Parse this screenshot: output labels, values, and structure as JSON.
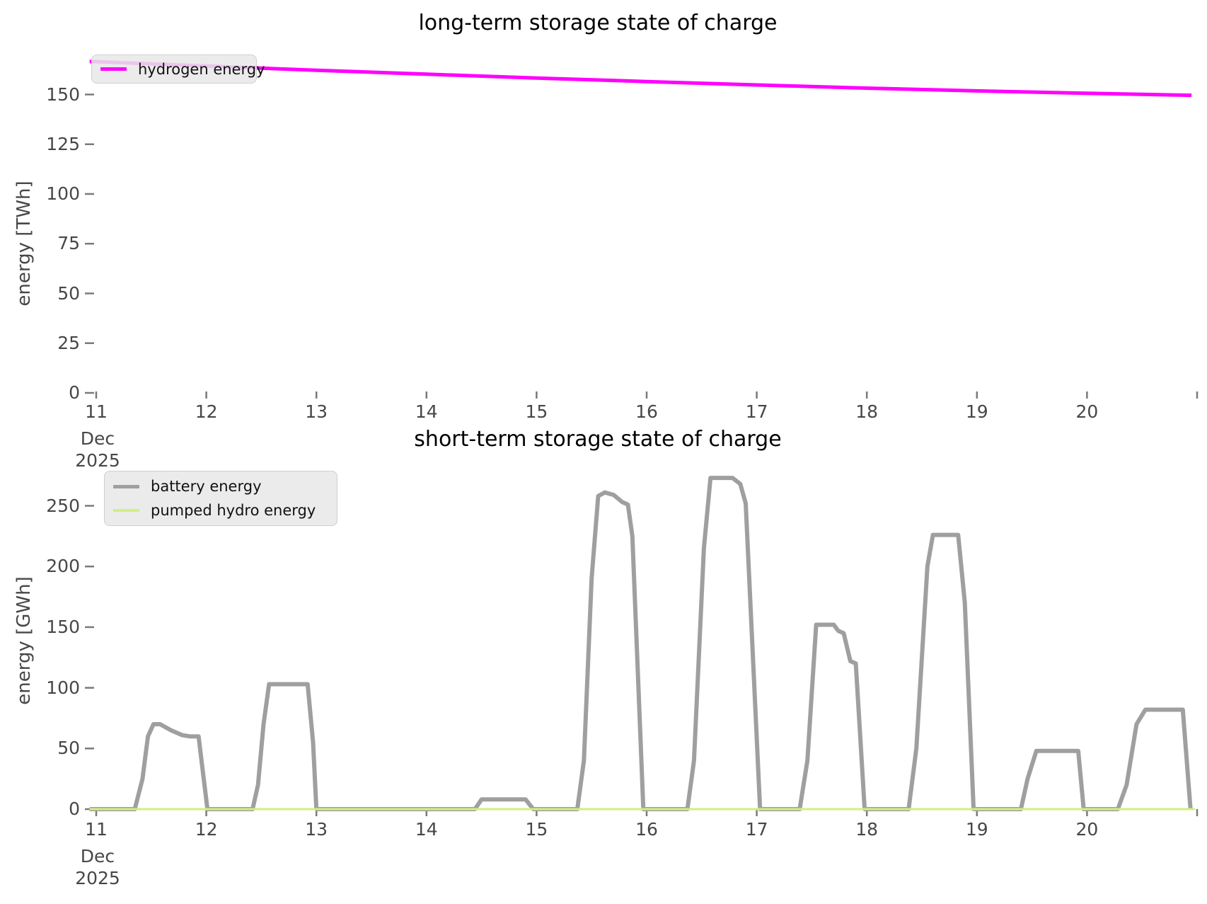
{
  "figure": {
    "background": "#ffffff"
  },
  "chart_data": [
    {
      "type": "line",
      "title": "long-term storage state of charge",
      "ylabel": "energy [TWh]",
      "xlabel": "",
      "grid": false,
      "legend_position": "upper-left",
      "xlim": [
        10.94,
        21.04
      ],
      "ylim": [
        0,
        168
      ],
      "y_ticks": [
        0,
        25,
        50,
        75,
        100,
        125,
        150
      ],
      "x_tick_days": [
        11,
        12,
        13,
        14,
        15,
        16,
        17,
        18,
        19,
        20,
        21
      ],
      "x_tick_labels": [
        "11",
        "12",
        "13",
        "14",
        "15",
        "16",
        "17",
        "18",
        "19",
        "20",
        ""
      ],
      "first_tick_sublabels": [
        "Dec",
        "2025"
      ],
      "legend": [
        {
          "label": "hydrogen energy",
          "color": "#ff00ff"
        }
      ],
      "series": [
        {
          "name": "hydrogen energy",
          "color": "#ff00ff",
          "width": 5,
          "x": [
            10.94,
            11,
            12,
            13,
            14,
            15,
            16,
            17,
            18,
            19,
            20,
            20.95
          ],
          "y": [
            166.6,
            166.5,
            164.3,
            162.2,
            160.2,
            158.3,
            156.5,
            154.8,
            153.2,
            151.8,
            150.6,
            149.6
          ]
        }
      ]
    },
    {
      "type": "line",
      "title": "short-term storage state of charge",
      "ylabel": "energy [GWh]",
      "xlabel": "",
      "grid": false,
      "legend_position": "upper-left",
      "xlim": [
        10.94,
        21.04
      ],
      "ylim": [
        0,
        285
      ],
      "y_ticks": [
        0,
        50,
        100,
        150,
        200,
        250
      ],
      "x_tick_days": [
        11,
        12,
        13,
        14,
        15,
        16,
        17,
        18,
        19,
        20,
        21
      ],
      "x_tick_labels": [
        "11",
        "12",
        "13",
        "14",
        "15",
        "16",
        "17",
        "18",
        "19",
        "20",
        ""
      ],
      "first_tick_sublabels": [
        "Dec",
        "2025"
      ],
      "legend": [
        {
          "label": "battery energy",
          "color": "#9f9f9f"
        },
        {
          "label": "pumped hydro energy",
          "color": "#d0f082"
        }
      ],
      "series": [
        {
          "name": "battery energy",
          "color": "#9f9f9f",
          "width": 6,
          "x": [
            10.94,
            11.35,
            11.42,
            11.47,
            11.52,
            11.58,
            11.68,
            11.78,
            11.85,
            11.93,
            11.97,
            12.01,
            12.42,
            12.47,
            12.52,
            12.57,
            12.92,
            12.97,
            13.0,
            14.44,
            14.5,
            14.9,
            14.97,
            15.37,
            15.43,
            15.5,
            15.56,
            15.62,
            15.7,
            15.78,
            15.83,
            15.87,
            15.97,
            16.37,
            16.43,
            16.52,
            16.58,
            16.78,
            16.85,
            16.9,
            17.03,
            17.39,
            17.46,
            17.54,
            17.7,
            17.74,
            17.79,
            17.85,
            17.9,
            17.98,
            18.38,
            18.45,
            18.55,
            18.6,
            18.83,
            18.89,
            18.97,
            19.4,
            19.46,
            19.54,
            19.92,
            19.97,
            20.28,
            20.36,
            20.45,
            20.53,
            20.87,
            20.94
          ],
          "y": [
            0,
            0,
            25,
            60,
            70,
            70,
            65,
            61,
            60,
            60,
            30,
            0,
            0,
            20,
            70,
            103,
            103,
            55,
            0,
            0,
            8,
            8,
            0,
            0,
            40,
            190,
            258,
            261,
            259,
            253,
            251,
            225,
            0,
            0,
            40,
            215,
            273,
            273,
            268,
            252,
            0,
            0,
            40,
            152,
            152,
            147,
            145,
            122,
            120,
            0,
            0,
            50,
            200,
            226,
            226,
            170,
            0,
            0,
            25,
            48,
            48,
            0,
            0,
            20,
            70,
            82,
            82,
            0
          ]
        },
        {
          "name": "pumped hydro energy",
          "color": "#d0f082",
          "width": 3,
          "x": [
            10.94,
            20.98
          ],
          "y": [
            0,
            0
          ]
        }
      ]
    }
  ]
}
